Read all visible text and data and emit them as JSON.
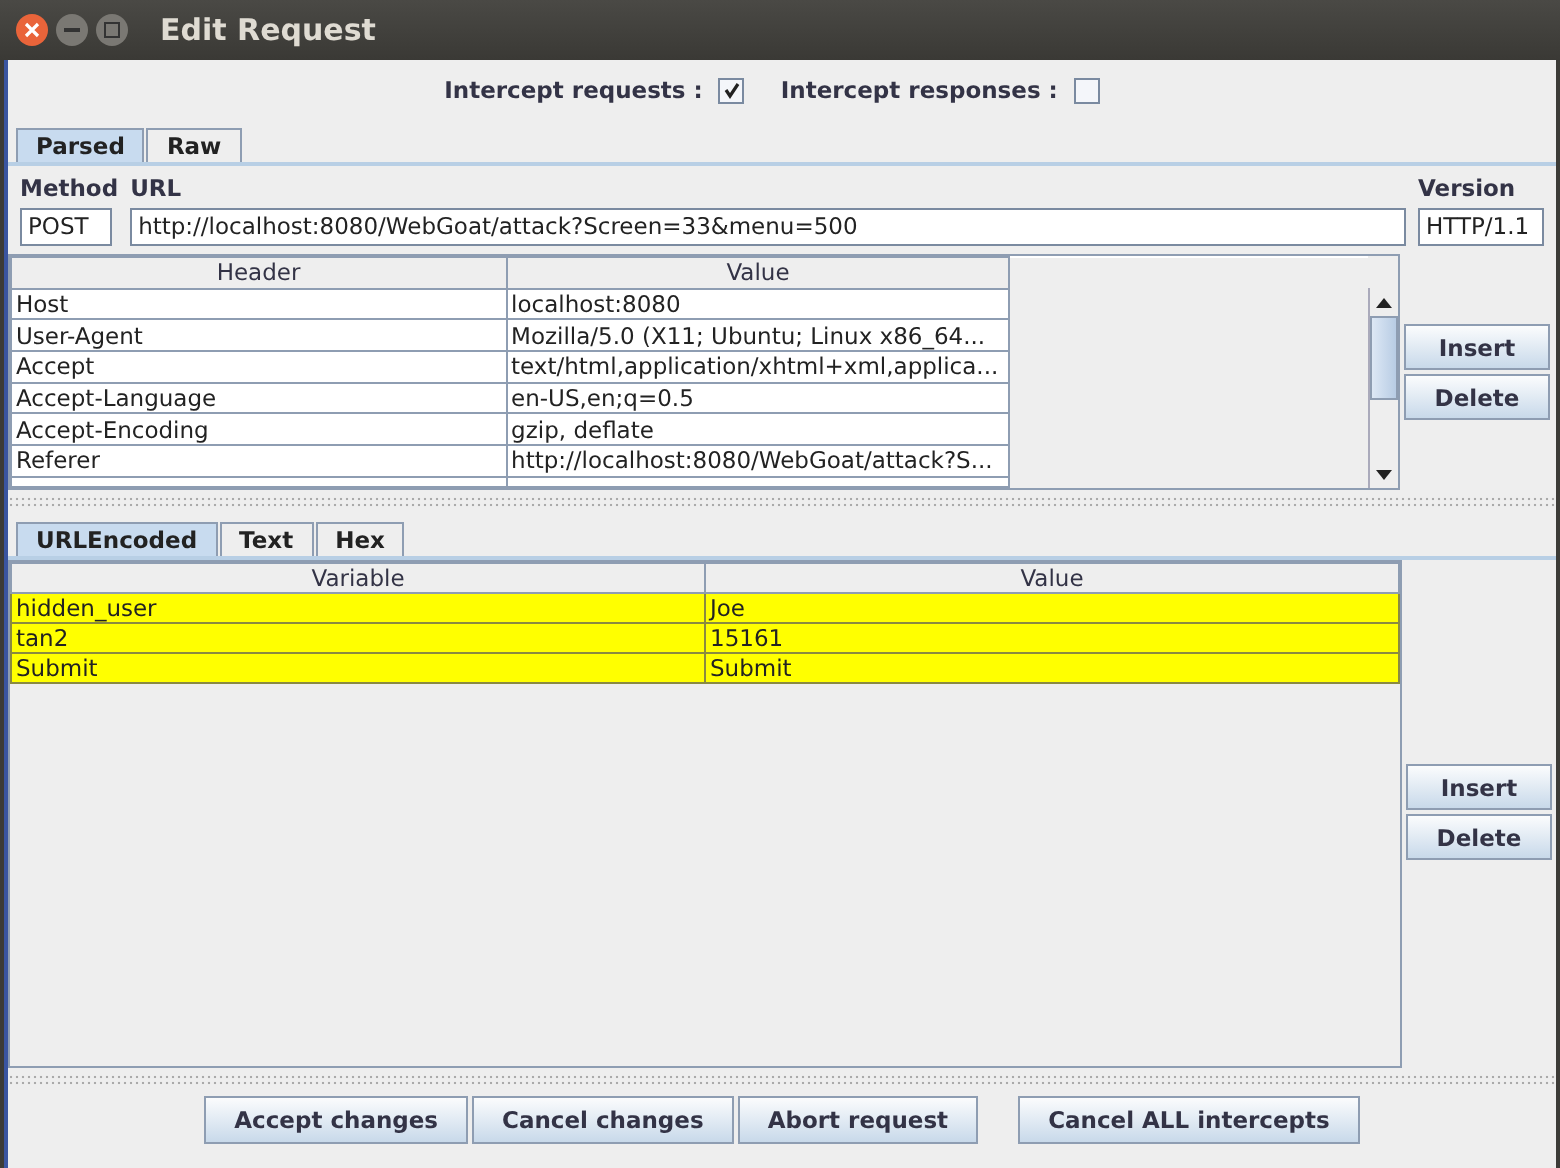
{
  "window": {
    "title": "Edit Request"
  },
  "intercept": [
    {
      "label": "Intercept requests :",
      "checked": true
    },
    {
      "label": "Intercept responses :",
      "checked": false
    }
  ],
  "request_tabs": [
    {
      "label": "Parsed",
      "selected": true
    },
    {
      "label": "Raw",
      "selected": false
    }
  ],
  "method": {
    "label": "Method",
    "value": "POST"
  },
  "url": {
    "label": "URL",
    "value": "http://localhost:8080/WebGoat/attack?Screen=33&menu=500"
  },
  "version": {
    "label": "Version",
    "value": "HTTP/1.1"
  },
  "headers": {
    "columns": [
      "Header",
      "Value"
    ],
    "rows": [
      [
        "Host",
        "localhost:8080"
      ],
      [
        "User-Agent",
        "Mozilla/5.0 (X11; Ubuntu; Linux x86_64..."
      ],
      [
        "Accept",
        "text/html,application/xhtml+xml,applica..."
      ],
      [
        "Accept-Language",
        "en-US,en;q=0.5"
      ],
      [
        "Accept-Encoding",
        "gzip, deflate"
      ],
      [
        "Referer",
        "http://localhost:8080/WebGoat/attack?S..."
      ]
    ],
    "buttons": [
      "Insert",
      "Delete"
    ]
  },
  "body_tabs": [
    {
      "label": "URLEncoded",
      "selected": true
    },
    {
      "label": "Text",
      "selected": false
    },
    {
      "label": "Hex",
      "selected": false
    }
  ],
  "variables": {
    "columns": [
      "Variable",
      "Value"
    ],
    "rows": [
      {
        "cells": [
          "hidden_user",
          "Joe"
        ],
        "highlighted": true
      },
      {
        "cells": [
          "tan2",
          "15161"
        ],
        "highlighted": true
      },
      {
        "cells": [
          "Submit",
          "Submit"
        ],
        "highlighted": true
      }
    ],
    "buttons": [
      "Insert",
      "Delete"
    ]
  },
  "actions": [
    "Accept changes",
    "Cancel changes",
    "Abort request",
    "Cancel ALL intercepts"
  ]
}
